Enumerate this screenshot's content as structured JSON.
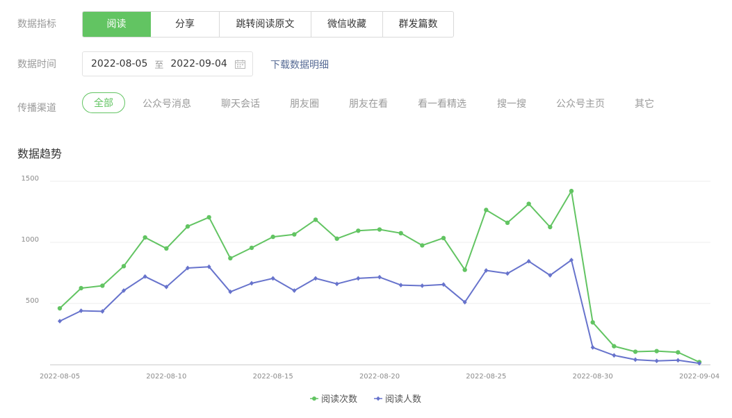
{
  "filters": {
    "metric_label": "数据指标",
    "metrics": [
      "阅读",
      "分享",
      "跳转阅读原文",
      "微信收藏",
      "群发篇数"
    ],
    "active_metric_index": 0,
    "time_label": "数据时间",
    "date_start": "2022-08-05",
    "date_sep": "至",
    "date_end": "2022-09-04",
    "download_label": "下载数据明细",
    "channel_label": "传播渠道",
    "channels": [
      "全部",
      "公众号消息",
      "聊天会话",
      "朋友圈",
      "朋友在看",
      "看一看精选",
      "搜一搜",
      "公众号主页",
      "其它"
    ],
    "active_channel_index": 0
  },
  "section_title": "数据趋势",
  "chart_data": {
    "type": "line",
    "title": "",
    "xlabel": "",
    "ylabel": "",
    "x": [
      "2022-08-05",
      "2022-08-06",
      "2022-08-07",
      "2022-08-08",
      "2022-08-09",
      "2022-08-10",
      "2022-08-11",
      "2022-08-12",
      "2022-08-13",
      "2022-08-14",
      "2022-08-15",
      "2022-08-16",
      "2022-08-17",
      "2022-08-18",
      "2022-08-19",
      "2022-08-20",
      "2022-08-21",
      "2022-08-22",
      "2022-08-23",
      "2022-08-24",
      "2022-08-25",
      "2022-08-26",
      "2022-08-27",
      "2022-08-28",
      "2022-08-29",
      "2022-08-30",
      "2022-08-31",
      "2022-09-01",
      "2022-09-02",
      "2022-09-03",
      "2022-09-04"
    ],
    "x_ticks": [
      "2022-08-05",
      "2022-08-10",
      "2022-08-15",
      "2022-08-20",
      "2022-08-25",
      "2022-08-30",
      "2022-09-04"
    ],
    "y_ticks": [
      500,
      1000,
      1500
    ],
    "ylim": [
      0,
      1500
    ],
    "grid": true,
    "legend_position": "bottom-center",
    "series": [
      {
        "name": "阅读次数",
        "color": "#62c462",
        "values": [
          460,
          625,
          645,
          805,
          1040,
          950,
          1130,
          1205,
          870,
          955,
          1045,
          1065,
          1185,
          1030,
          1095,
          1105,
          1075,
          975,
          1035,
          775,
          1265,
          1160,
          1315,
          1125,
          1420,
          345,
          150,
          105,
          110,
          100,
          20
        ]
      },
      {
        "name": "阅读人数",
        "color": "#6773cc",
        "values": [
          355,
          440,
          435,
          605,
          720,
          635,
          790,
          800,
          595,
          665,
          705,
          605,
          705,
          660,
          705,
          715,
          650,
          645,
          655,
          510,
          770,
          745,
          845,
          730,
          855,
          140,
          75,
          40,
          30,
          35,
          10
        ]
      }
    ]
  }
}
